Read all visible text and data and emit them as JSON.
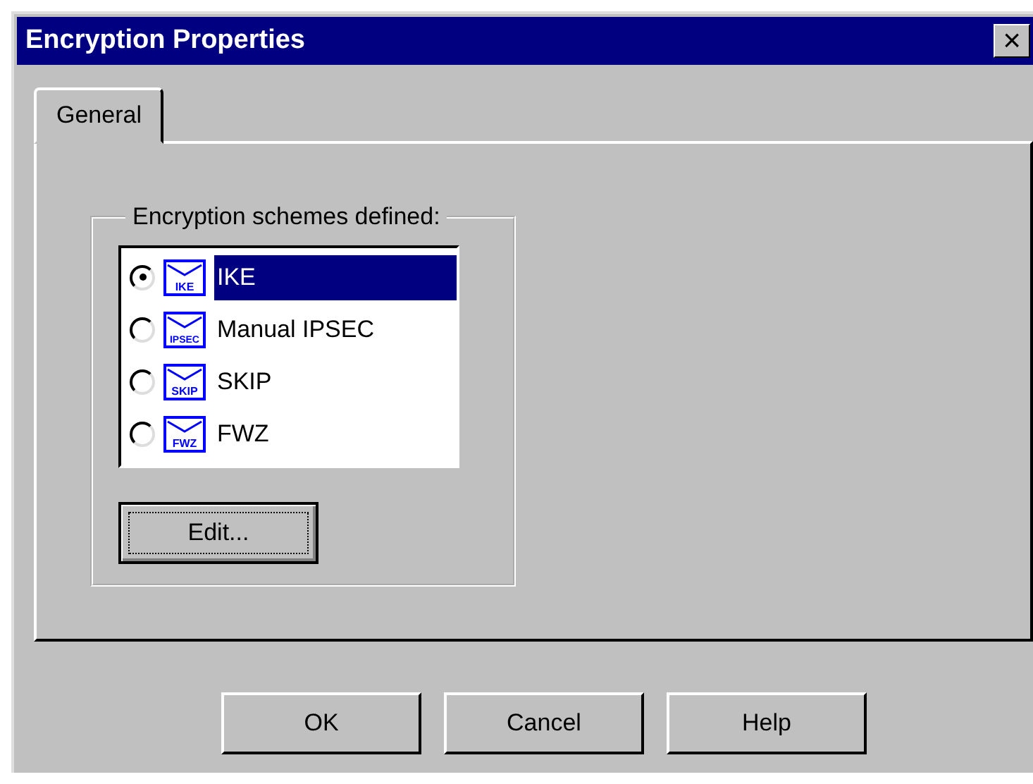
{
  "window": {
    "title": "Encryption Properties",
    "close": "×"
  },
  "tabs": [
    {
      "label": "General",
      "selected": true
    }
  ],
  "group": {
    "label": "Encryption schemes defined:",
    "schemes": [
      {
        "name": "IKE",
        "icon_label": "IKE",
        "checked": true,
        "selected": true
      },
      {
        "name": "Manual IPSEC",
        "icon_label": "IPSEC",
        "checked": false,
        "selected": false
      },
      {
        "name": "SKIP",
        "icon_label": "SKIP",
        "checked": false,
        "selected": false
      },
      {
        "name": "FWZ",
        "icon_label": "FWZ",
        "checked": false,
        "selected": false
      }
    ],
    "edit_button": "Edit..."
  },
  "buttons": [
    "OK",
    "Cancel",
    "Help"
  ]
}
